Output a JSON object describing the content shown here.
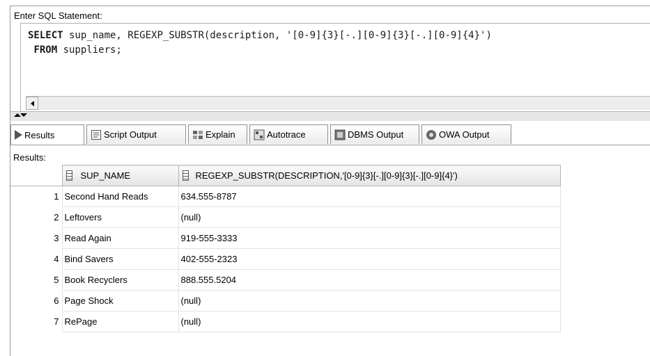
{
  "editor": {
    "label": "Enter SQL Statement:",
    "line1_kw": "SELECT",
    "line1_rest": " sup_name, REGEXP_SUBSTR(description, '[0-9]{3}[-.][0-9]{3}[-.][0-9]{4}')",
    "line2_kw": "FROM",
    "line2_rest": " suppliers;"
  },
  "tabs": [
    {
      "label": "Results",
      "icon": "play-icon",
      "active": true
    },
    {
      "label": "Script Output",
      "icon": "script-icon"
    },
    {
      "label": "Explain",
      "icon": "explain-icon"
    },
    {
      "label": "Autotrace",
      "icon": "autotrace-icon"
    },
    {
      "label": "DBMS Output",
      "icon": "dbms-icon"
    },
    {
      "label": "OWA Output",
      "icon": "owa-icon"
    }
  ],
  "results": {
    "label": "Results:",
    "columns": [
      "SUP_NAME",
      "REGEXP_SUBSTR(DESCRIPTION,'[0-9]{3}[-.][0-9]{3}[-.][0-9]{4}')"
    ],
    "rows": [
      {
        "n": "1",
        "sup_name": "Second Hand Reads",
        "phone": "634.555-8787"
      },
      {
        "n": "2",
        "sup_name": "Leftovers",
        "phone": "(null)"
      },
      {
        "n": "3",
        "sup_name": "Read Again",
        "phone": "919-555-3333"
      },
      {
        "n": "4",
        "sup_name": "Bind Savers",
        "phone": "402-555-2323"
      },
      {
        "n": "5",
        "sup_name": "Book Recyclers",
        "phone": "888.555.5204"
      },
      {
        "n": "6",
        "sup_name": "Page Shock",
        "phone": "(null)"
      },
      {
        "n": "7",
        "sup_name": "RePage",
        "phone": "(null)"
      }
    ]
  }
}
